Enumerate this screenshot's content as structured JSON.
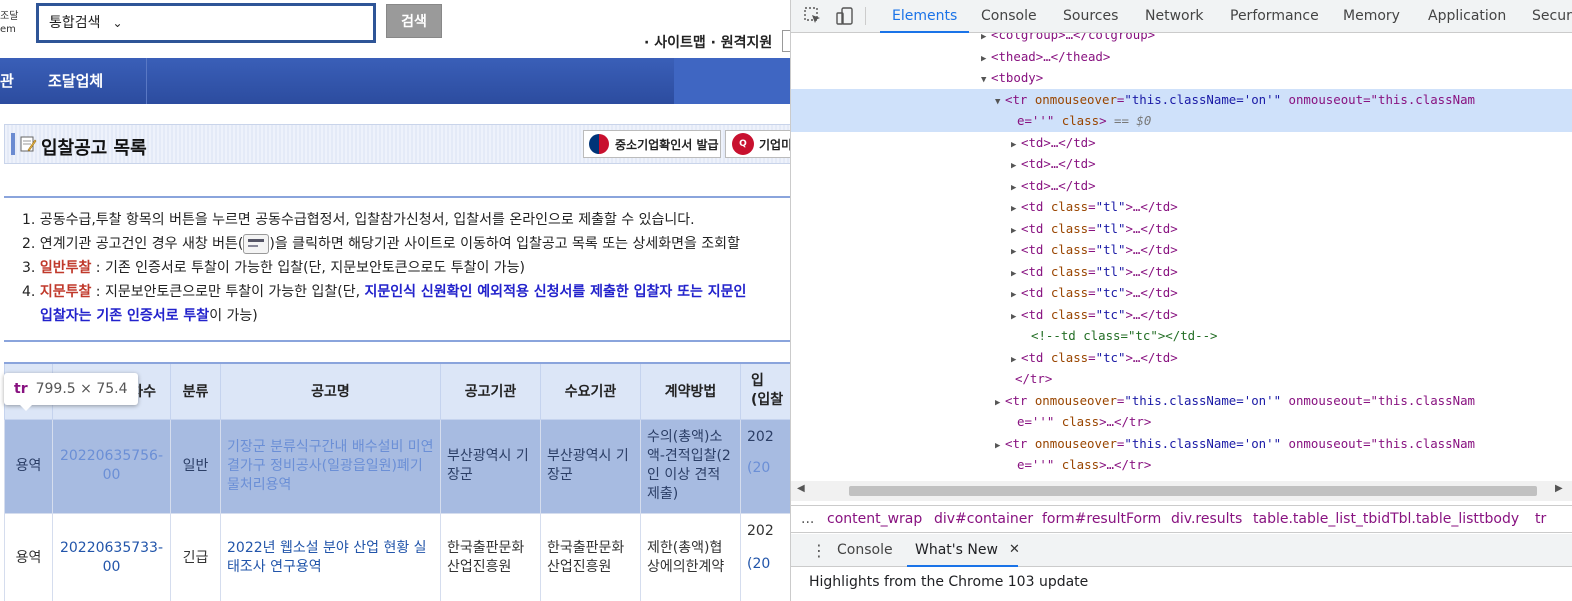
{
  "page": {
    "logo_fragment": [
      "조달",
      "em"
    ],
    "search": {
      "selected_option": "통합검색",
      "value": "",
      "button": "검색"
    },
    "util_links": "· 사이트맵 · 원격지원",
    "gnb": [
      "관",
      "조달업체"
    ],
    "title": "입찰공고 목록",
    "cert_button": "중소기업확인서 발급",
    "cert_button2": "기업미",
    "notice": {
      "item1": "1. 공동수급,투찰 항목의 버튼을 누르면 공동수급협정서, 입찰참가신청서, 입찰서를 온라인으로 제출할 수 있습니다.",
      "item2_a": "2. 연계기관 공고건인 경우 새창 버튼(",
      "item2_b": ")을 클릭하면 해당기관 사이트로 이동하여 입찰공고 목록 또는 상세화면을 조회할",
      "item3_num": "3. ",
      "item3_label": "일반투찰",
      "item3_text": " : 기존 인증서로 투찰이 가능한 입찰(단, 지문보안토큰으로도 투찰이 가능)",
      "item4_num": "4. ",
      "item4_label": "지문투찰",
      "item4_text": " : 지문보안토큰으로만 투찰이 가능한 입찰(단, ",
      "item4_blue": "지문인식 신원확인 예외적용 신청서를 제출한 입찰자 또는 지문인",
      "item4_blue2": "입찰자는 기존 인증서로 투찰",
      "item4_tail": "이 가능)"
    },
    "table": {
      "headers": [
        "",
        "차수",
        "분류",
        "공고명",
        "공고기관",
        "수요기관",
        "계약방법",
        "입\n(입찰"
      ],
      "rows": [
        {
          "type": "용역",
          "no": "20220635756-00",
          "category": "일반",
          "name": "기장군 분류식구간내 배수설비 미연결가구 정비공사(일광읍일원)폐기물처리용역",
          "agency": "부산광역시 기장군",
          "demand": "부산광역시 기장군",
          "method": "수의(총액)소액-견적입찰(2인 이상 견적 제출)",
          "date1": "202",
          "date2": "(20"
        },
        {
          "type": "용역",
          "no": "20220635733-00",
          "category": "긴급",
          "name": "2022년 웹소설 분야 산업 현황 실태조사 연구용역",
          "agency": "한국출판문화산업진흥원",
          "demand": "한국출판문화산업진흥원",
          "method": "제한(총액)협상에의한계약",
          "date1": "202",
          "date2": "(20"
        }
      ]
    },
    "tooltip": {
      "tag": "tr",
      "size": "799.5 × 75.4"
    }
  },
  "devtools": {
    "tabs": [
      "Elements",
      "Console",
      "Sources",
      "Network",
      "Performance",
      "Memory",
      "Application",
      "Secur"
    ],
    "active_tab": "Elements",
    "dom_lines": [
      {
        "tri": "▶",
        "text": "<colgroup>…</colgroup>"
      },
      {
        "tri": "▶",
        "text": "<thead>…</thead>"
      },
      {
        "tri": "▼",
        "text": "<tbody>"
      },
      {
        "tri": "▼",
        "text": "<tr onmouseover=\"this.className='on'\" onmouseout=\"this.classNam",
        "selected": true
      },
      {
        "tri": "",
        "text": "e=''\" class> == $0",
        "selected": true
      },
      {
        "tri": "▶",
        "text": "<td>…</td>"
      },
      {
        "tri": "▶",
        "text": "<td>…</td>"
      },
      {
        "tri": "▶",
        "text": "<td>…</td>"
      },
      {
        "tri": "▶",
        "text": "<td class=\"tl\">…</td>"
      },
      {
        "tri": "▶",
        "text": "<td class=\"tl\">…</td>"
      },
      {
        "tri": "▶",
        "text": "<td class=\"tl\">…</td>"
      },
      {
        "tri": "▶",
        "text": "<td class=\"tl\">…</td>"
      },
      {
        "tri": "▶",
        "text": "<td class=\"tc\">…</td>"
      },
      {
        "tri": "▶",
        "text": "<td class=\"tc\">…</td>"
      },
      {
        "tri": "",
        "text": "<!--td class=\"tc\"></td-->"
      },
      {
        "tri": "▶",
        "text": "<td class=\"tc\">…</td>"
      },
      {
        "tri": "",
        "text": "</tr>"
      },
      {
        "tri": "▶",
        "text": "<tr onmouseover=\"this.className='on'\" onmouseout=\"this.classNam"
      },
      {
        "tri": "",
        "text": "e=''\" class>…</tr>"
      },
      {
        "tri": "▶",
        "text": "<tr onmouseover=\"this.className='on'\" onmouseout=\"this.classNam"
      },
      {
        "tri": "",
        "text": "e=''\" class>…</tr>"
      }
    ],
    "breadcrumbs": [
      "...",
      "content_wrap",
      "div#container",
      "form#resultForm",
      "div.results",
      "table.table_list_tbidTbl.table_list",
      "tbody",
      "tr"
    ],
    "drawer_tabs": [
      "Console",
      "What's New"
    ],
    "drawer_active": "What's New",
    "whats_new_text": "Highlights from the Chrome 103 update"
  }
}
